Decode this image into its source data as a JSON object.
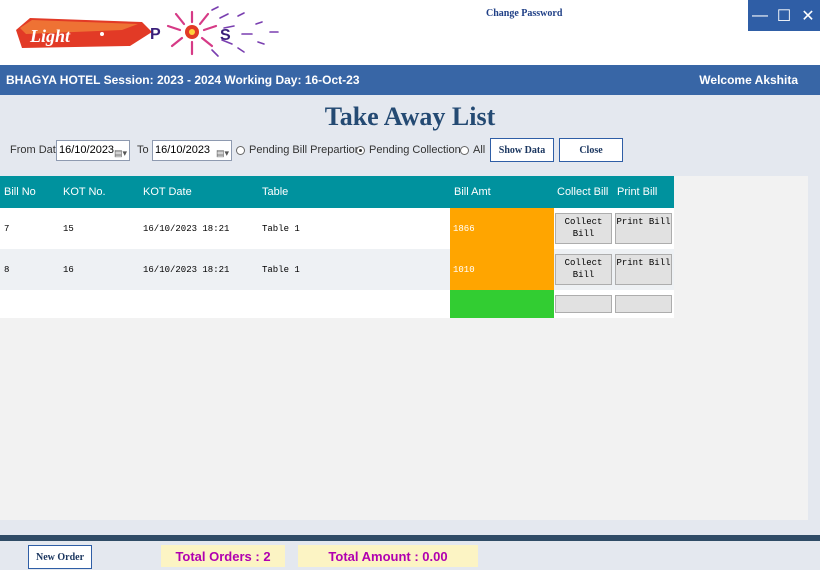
{
  "header": {
    "logo_text": "Light POS",
    "change_password": "Change Password",
    "window_controls": {
      "minimize": "—",
      "maximize": "☐",
      "close": "✕"
    }
  },
  "session": {
    "hotel": "BHAGYA HOTEL",
    "session_label": "Session:",
    "session_value": "2023 - 2024",
    "working_day_label": "Working Day:",
    "working_day_value": "16-Oct-23",
    "welcome": "Welcome  Akshita"
  },
  "page": {
    "title": "Take Away List"
  },
  "filters": {
    "from_label": "From Date",
    "from_value": "16/10/2023",
    "to_label": "To",
    "to_value": "16/10/2023",
    "options": [
      {
        "label": "Pending Bill Prepartion",
        "selected": false
      },
      {
        "label": "Pending Collection",
        "selected": true
      },
      {
        "label": "All",
        "selected": false
      }
    ],
    "show_data": "Show Data",
    "close": "Close"
  },
  "table": {
    "columns": [
      "Bill No",
      "KOT No.",
      "KOT Date",
      "Table",
      "Bill Amt",
      "Collect Bill",
      "Print Bill"
    ],
    "rows": [
      {
        "bill_no": "7",
        "kot_no": "15",
        "kot_date": "16/10/2023 18:21",
        "table": "Table 1",
        "amount": "1866",
        "collect": "Collect Bill",
        "print": "Print Bill"
      },
      {
        "bill_no": "8",
        "kot_no": "16",
        "kot_date": "16/10/2023 18:21",
        "table": "Table 1",
        "amount": "1010",
        "collect": "Collect Bill",
        "print": "Print Bill"
      }
    ]
  },
  "footer": {
    "new_order": "New Order",
    "total_orders": "Total Orders : 2",
    "total_amount": "Total Amount : 0.00"
  },
  "colors": {
    "header_bar": "#3866a6",
    "grid_header": "#00929e",
    "amount_cell": "#ffa500",
    "total_cell": "#32cd32",
    "title": "#244a73"
  }
}
